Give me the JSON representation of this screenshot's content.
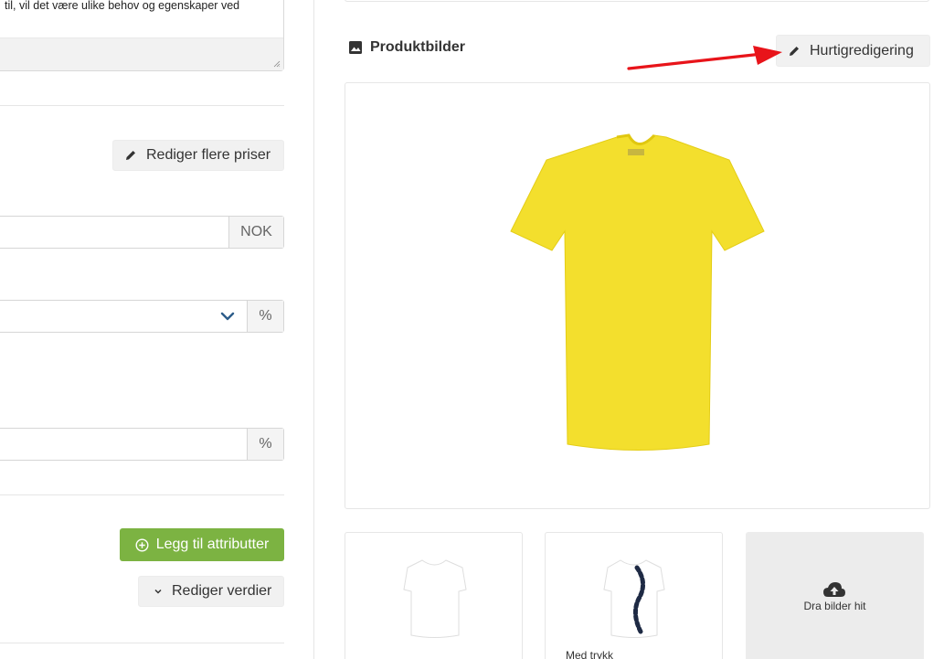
{
  "description": {
    "text": "til, vil det være ulike behov og egenskaper ved"
  },
  "pricing": {
    "edit_prices_label": "Rediger flere priser",
    "price_value": "",
    "currency": "NOK",
    "vat_value": "",
    "vat_unit": "%",
    "discount_value": "",
    "discount_unit": "%"
  },
  "attributes": {
    "add_label": "Legg til attributter",
    "edit_values_label": "Rediger verdier"
  },
  "product_images": {
    "title": "Produktbilder",
    "quick_edit_label": "Hurtigredigering",
    "main_image_icon": "yellow-tshirt-image",
    "thumbnails": [
      {
        "icon": "white-tshirt-image",
        "caption": ""
      },
      {
        "icon": "printed-tshirt-image",
        "caption": "Med trykk"
      }
    ],
    "dropzone_label": "Dra bilder hit"
  },
  "colors": {
    "accent_green": "#7cb342",
    "arrow_red": "#e8141a",
    "shirt_yellow": "#f3df2d"
  }
}
